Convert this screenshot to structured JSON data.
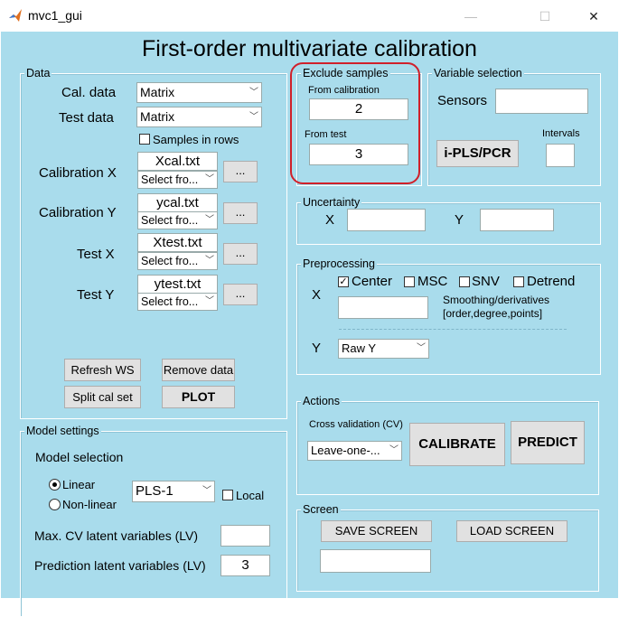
{
  "window": {
    "title": "mvc1_gui",
    "minimize": "—",
    "maximize": "☐",
    "close": "✕"
  },
  "main_title": "First-order multivariate calibration",
  "data_panel": {
    "title": "Data",
    "cal_data_label": "Cal. data",
    "cal_data_value": "Matrix",
    "test_data_label": "Test data",
    "test_data_value": "Matrix",
    "samples_in_rows": "Samples in rows",
    "cal_x_label": "Calibration X",
    "cal_x_file": "Xcal.txt",
    "cal_x_select": "Select fro...",
    "cal_y_label": "Calibration Y",
    "cal_y_file": "ycal.txt",
    "cal_y_select": "Select fro...",
    "test_x_label": "Test X",
    "test_x_file": "Xtest.txt",
    "test_x_select": "Select fro...",
    "test_y_label": "Test Y",
    "test_y_file": "ytest.txt",
    "test_y_select": "Select fro...",
    "browse": "...",
    "refresh_ws": "Refresh WS",
    "remove_data": "Remove data",
    "split_cal_set": "Split cal set",
    "plot": "PLOT"
  },
  "model_panel": {
    "title": "Model settings",
    "model_selection": "Model selection",
    "linear": "Linear",
    "nonlinear": "Non-linear",
    "algorithm": "PLS-1",
    "local": "Local",
    "max_cv_label": "Max. CV latent variables (LV)",
    "max_cv_value": "",
    "pred_lv_label": "Prediction latent variables (LV)",
    "pred_lv_value": "3"
  },
  "exclude_panel": {
    "title": "Exclude samples",
    "from_cal_label": "From calibration",
    "from_cal_value": "2",
    "from_test_label": "From test",
    "from_test_value": "3"
  },
  "varsel_panel": {
    "title": "Variable selection",
    "sensors_label": "Sensors",
    "sensors_value": "",
    "intervals_label": "Intervals",
    "intervals_value": "",
    "ipls_button": "i-PLS/PCR"
  },
  "uncertainty_panel": {
    "title": "Uncertainty",
    "x_label": "X",
    "x_value": "",
    "y_label": "Y",
    "y_value": ""
  },
  "preprocessing_panel": {
    "title": "Preprocessing",
    "x_label": "X",
    "center": "Center",
    "msc": "MSC",
    "snv": "SNV",
    "detrend": "Detrend",
    "smoothing_label_1": "Smoothing/derivatives",
    "smoothing_label_2": "[order,degree,points]",
    "smoothing_value": "",
    "y_label": "Y",
    "y_select": "Raw Y"
  },
  "actions_panel": {
    "title": "Actions",
    "cv_label": "Cross validation (CV)",
    "cv_select": "Leave-one-...",
    "calibrate": "CALIBRATE",
    "predict": "PREDICT"
  },
  "screen_panel": {
    "title": "Screen",
    "save": "SAVE SCREEN",
    "load": "LOAD SCREEN",
    "filename_value": ""
  },
  "colors": {
    "background": "#a9dcec",
    "highlight": "#d0202a"
  }
}
